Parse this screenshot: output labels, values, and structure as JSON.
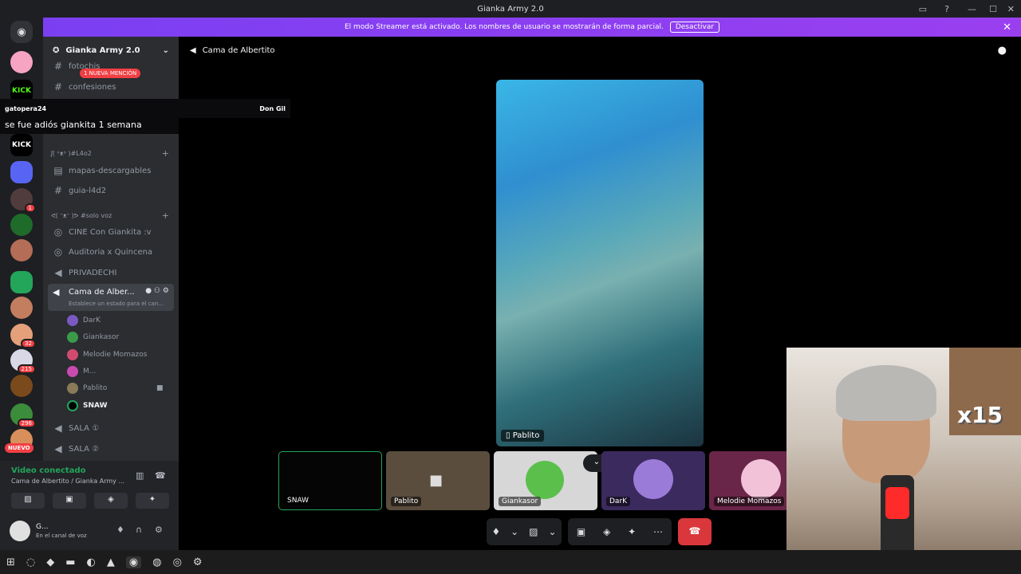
{
  "window": {
    "title": "Gianka Army 2.0"
  },
  "streamer_banner": {
    "text": "El modo Streamer está activado. Los nombres de usuario se mostrarán de forma parcial.",
    "button": "Desactivar"
  },
  "server": {
    "name": "Gianka Army 2.0",
    "mention_badge": "1 NUEVA MENCIÓN",
    "nuevo_badge": "NUEVO"
  },
  "server_badges": {
    "a": "1",
    "b": "32",
    "c": "215",
    "d": "296"
  },
  "server_labels": {
    "kick": "KICK"
  },
  "channels": {
    "top": [
      {
        "name": "fotochis"
      },
      {
        "name": "confesiones"
      }
    ],
    "cat1": "ᶘ( ᵒᴥᵒ )#L4o2",
    "cat1_items": [
      "mapas-descargables",
      "guia-l4d2"
    ],
    "cat2": "ᕙ( ᵔᴥᵔ )ᕗ #solo voz",
    "cat2_items": [
      "CINE Con Giankita :v",
      "Auditoria x Quincena",
      "PRIVADECHI"
    ],
    "active": {
      "name": "Cama de Alber...",
      "status": "Establece un estado para el can..."
    },
    "users": [
      "DarK",
      "Giankasor",
      "Melodie Momazos",
      "M...",
      "Pablito",
      "SNAW"
    ],
    "sala1": "SALA ①",
    "sala2": "SALA ②"
  },
  "toast": {
    "user": "gatopera24",
    "other": "Don Gil",
    "message": "se fue adiós giankita 1 semana"
  },
  "main": {
    "title": "Cama de Albertito",
    "focused_label": "Pablito"
  },
  "tiles": [
    {
      "label": "SNAW"
    },
    {
      "label": "Pablito"
    },
    {
      "label": "Giankasor"
    },
    {
      "label": "DarK"
    },
    {
      "label": "Melodie Momazos"
    }
  ],
  "voice": {
    "status": "Video conectado",
    "channel": "Cama de Albertito / Gianka Army ...",
    "user": "G...",
    "user_sub": "En el canal de voz"
  },
  "webcam": {
    "overlay": "x15"
  },
  "colors": {
    "accent": "#5865f2",
    "banner": "#9a3ff0",
    "green": "#23a55a",
    "red": "#da373c"
  }
}
